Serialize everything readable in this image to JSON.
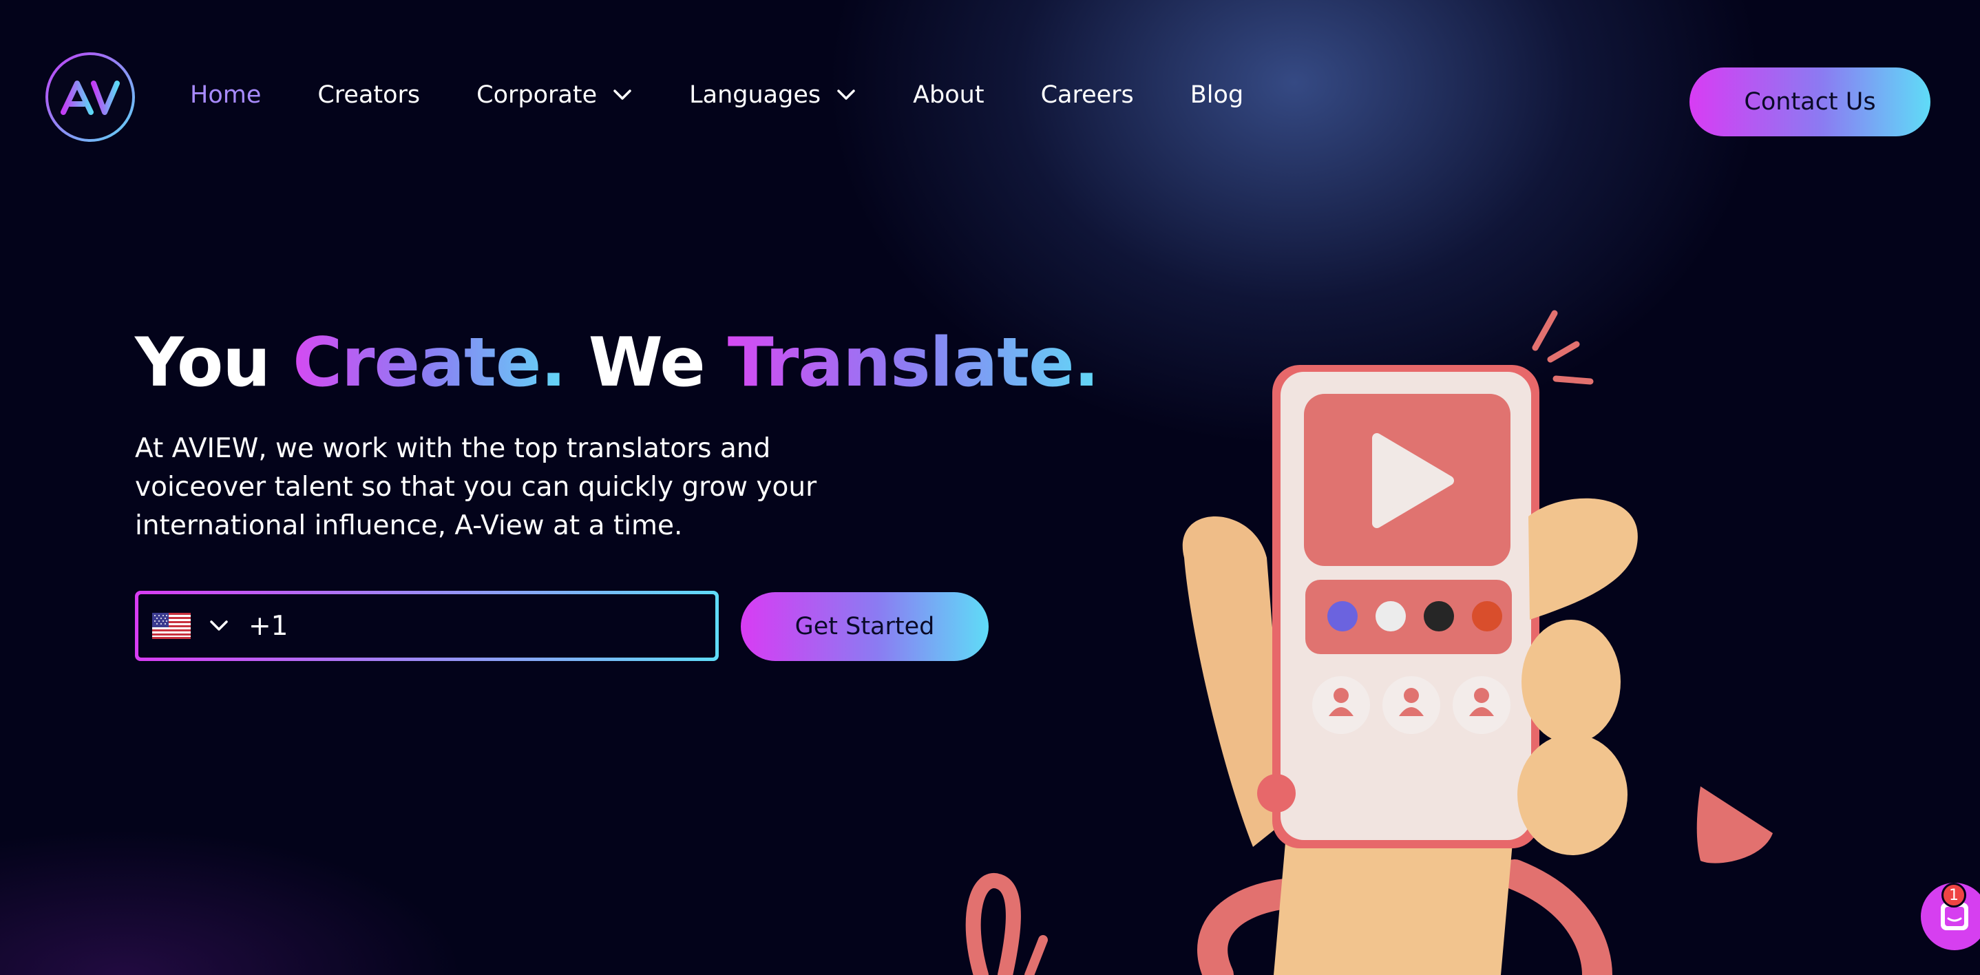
{
  "nav": {
    "items": [
      {
        "label": "Home",
        "active": true,
        "has_dropdown": false
      },
      {
        "label": "Creators",
        "active": false,
        "has_dropdown": false
      },
      {
        "label": "Corporate",
        "active": false,
        "has_dropdown": true
      },
      {
        "label": "Languages",
        "active": false,
        "has_dropdown": true
      },
      {
        "label": "About",
        "active": false,
        "has_dropdown": false
      },
      {
        "label": "Careers",
        "active": false,
        "has_dropdown": false
      },
      {
        "label": "Blog",
        "active": false,
        "has_dropdown": false
      }
    ],
    "contact_label": "Contact Us"
  },
  "hero": {
    "headline": {
      "part1": "You ",
      "part2": "Create.",
      "part3": " We ",
      "part4": "Translate."
    },
    "description": "At AVIEW, we work with the top translators and voiceover talent so that you can quickly grow your international influence, A-View at a time.",
    "phone": {
      "country_icon": "us-flag-icon",
      "value": "+1"
    },
    "cta_label": "Get Started"
  },
  "chat": {
    "badge_count": "1",
    "icon": "chat-icon"
  },
  "colors": {
    "background": "#03031a",
    "gradient_start": "#d83cf3",
    "gradient_end": "#5fdcf7",
    "active_nav": "#a88bff",
    "illustration_pink": "#e2716f",
    "hand": "#f2c48e"
  }
}
